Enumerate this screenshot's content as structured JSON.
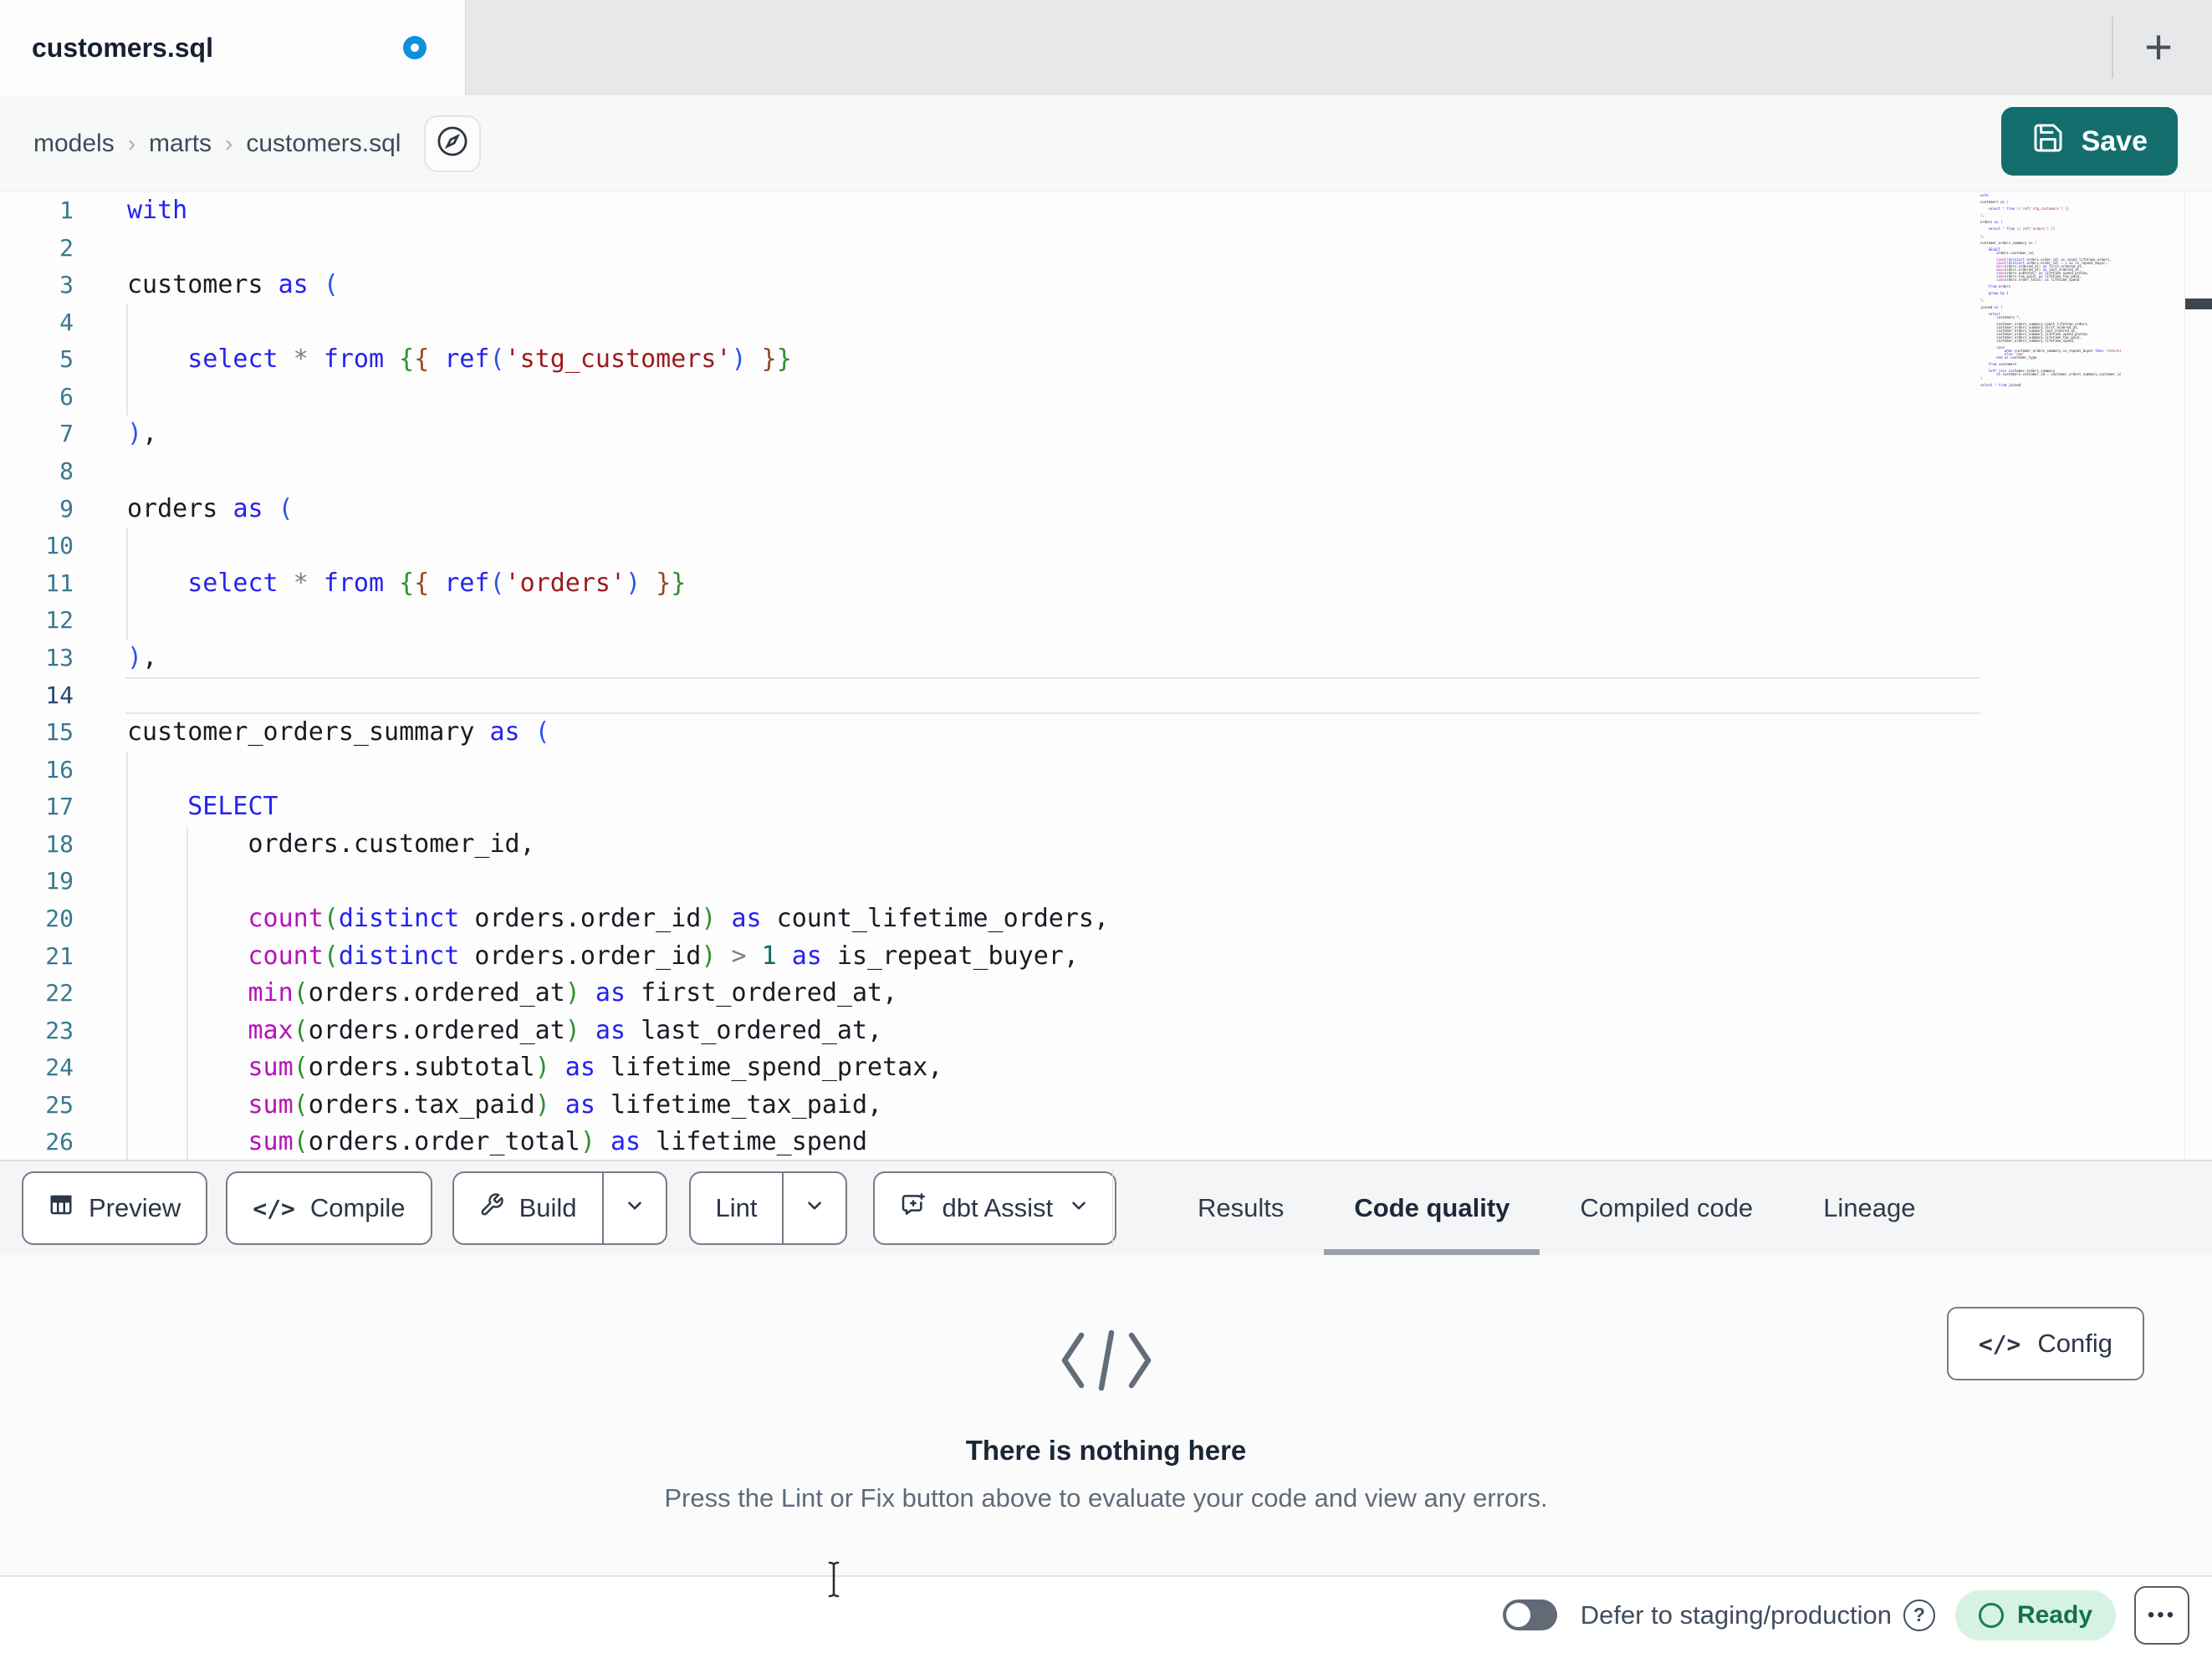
{
  "tab_bar": {
    "active_tab": "customers.sql",
    "new_tab_glyph": "+"
  },
  "breadcrumb": {
    "items": [
      "models",
      "marts",
      "customers.sql"
    ],
    "separator": "›"
  },
  "save_button": {
    "label": "Save"
  },
  "toolbar": {
    "preview": "Preview",
    "compile": "Compile",
    "build": "Build",
    "lint": "Lint",
    "dbt_assist": "dbt Assist",
    "code_glyph": "</>"
  },
  "result_tabs": [
    {
      "label": "Results",
      "active": false
    },
    {
      "label": "Code quality",
      "active": true
    },
    {
      "label": "Compiled code",
      "active": false
    },
    {
      "label": "Lineage",
      "active": false
    }
  ],
  "empty_state": {
    "title": "There is nothing here",
    "subtitle": "Press the Lint or Fix button above to evaluate your code and view any errors.",
    "config_label": "Config",
    "config_glyph": "</>"
  },
  "status_bar": {
    "defer_label": "Defer to staging/production",
    "help_glyph": "?",
    "ready_label": "Ready",
    "menu_glyph": "•••"
  },
  "colors": {
    "accent_teal": "#146e6e",
    "unsaved_dot_blue": "#0f90da",
    "ready_bg": "#d6f2e2",
    "ready_text": "#15714b",
    "syntax_keyword": "#2522f0",
    "syntax_function": "#b712b7",
    "syntax_string": "#9b1b1b",
    "syntax_number": "#0c7060",
    "bracket_level_1": "#2d51e8",
    "bracket_level_2": "#2f8f2f",
    "bracket_level_3": "#96491c"
  },
  "editor": {
    "active_line": 14,
    "lines": [
      {
        "n": "1",
        "guides": [],
        "active": false,
        "tokens": [
          [
            "kw",
            "with"
          ]
        ]
      },
      {
        "n": "2",
        "guides": [],
        "active": false,
        "tokens": []
      },
      {
        "n": "3",
        "guides": [],
        "active": false,
        "tokens": [
          [
            "id",
            "customers "
          ],
          [
            "kw",
            "as "
          ],
          [
            "b1",
            "("
          ]
        ]
      },
      {
        "n": "4",
        "guides": [
          0
        ],
        "active": false,
        "tokens": []
      },
      {
        "n": "5",
        "guides": [
          0
        ],
        "active": false,
        "tokens": [
          [
            "id",
            "    "
          ],
          [
            "kw",
            "select"
          ],
          [
            "id",
            " "
          ],
          [
            "op",
            "*"
          ],
          [
            "id",
            " "
          ],
          [
            "kw",
            "from"
          ],
          [
            "id",
            " "
          ],
          [
            "b2",
            "{"
          ],
          [
            "b3",
            "{"
          ],
          [
            "id",
            " "
          ],
          [
            "kw",
            "ref"
          ],
          [
            "b1",
            "("
          ],
          [
            "str",
            "'stg_customers'"
          ],
          [
            "b1",
            ")"
          ],
          [
            "id",
            " "
          ],
          [
            "b3",
            "}"
          ],
          [
            "b2",
            "}"
          ]
        ]
      },
      {
        "n": "6",
        "guides": [
          0
        ],
        "active": false,
        "tokens": []
      },
      {
        "n": "7",
        "guides": [],
        "active": false,
        "tokens": [
          [
            "b1",
            ")"
          ],
          [
            "id",
            ","
          ]
        ]
      },
      {
        "n": "8",
        "guides": [],
        "active": false,
        "tokens": []
      },
      {
        "n": "9",
        "guides": [],
        "active": false,
        "tokens": [
          [
            "id",
            "orders "
          ],
          [
            "kw",
            "as "
          ],
          [
            "b1",
            "("
          ]
        ]
      },
      {
        "n": "10",
        "guides": [
          0
        ],
        "active": false,
        "tokens": []
      },
      {
        "n": "11",
        "guides": [
          0
        ],
        "active": false,
        "tokens": [
          [
            "id",
            "    "
          ],
          [
            "kw",
            "select"
          ],
          [
            "id",
            " "
          ],
          [
            "op",
            "*"
          ],
          [
            "id",
            " "
          ],
          [
            "kw",
            "from"
          ],
          [
            "id",
            " "
          ],
          [
            "b2",
            "{"
          ],
          [
            "b3",
            "{"
          ],
          [
            "id",
            " "
          ],
          [
            "kw",
            "ref"
          ],
          [
            "b1",
            "("
          ],
          [
            "str",
            "'orders'"
          ],
          [
            "b1",
            ")"
          ],
          [
            "id",
            " "
          ],
          [
            "b3",
            "}"
          ],
          [
            "b2",
            "}"
          ]
        ]
      },
      {
        "n": "12",
        "guides": [
          0
        ],
        "active": false,
        "tokens": []
      },
      {
        "n": "13",
        "guides": [],
        "active": false,
        "tokens": [
          [
            "b1",
            ")"
          ],
          [
            "id",
            ","
          ]
        ]
      },
      {
        "n": "14",
        "guides": [],
        "active": true,
        "tokens": []
      },
      {
        "n": "15",
        "guides": [],
        "active": false,
        "tokens": [
          [
            "id",
            "customer_orders_summary "
          ],
          [
            "kw",
            "as "
          ],
          [
            "b1",
            "("
          ]
        ]
      },
      {
        "n": "16",
        "guides": [
          0
        ],
        "active": false,
        "tokens": []
      },
      {
        "n": "17",
        "guides": [
          0
        ],
        "active": false,
        "tokens": [
          [
            "id",
            "    "
          ],
          [
            "kw",
            "SELECT"
          ]
        ]
      },
      {
        "n": "18",
        "guides": [
          0,
          4
        ],
        "active": false,
        "tokens": [
          [
            "id",
            "        orders.customer_id,"
          ]
        ]
      },
      {
        "n": "19",
        "guides": [
          0,
          4
        ],
        "active": false,
        "tokens": []
      },
      {
        "n": "20",
        "guides": [
          0,
          4
        ],
        "active": false,
        "tokens": [
          [
            "id",
            "        "
          ],
          [
            "fn",
            "count"
          ],
          [
            "b2",
            "("
          ],
          [
            "kw",
            "distinct"
          ],
          [
            "id",
            " orders.order_id"
          ],
          [
            "b2",
            ")"
          ],
          [
            "kw",
            " as"
          ],
          [
            "id",
            " count_lifetime_orders,"
          ]
        ]
      },
      {
        "n": "21",
        "guides": [
          0,
          4
        ],
        "active": false,
        "tokens": [
          [
            "id",
            "        "
          ],
          [
            "fn",
            "count"
          ],
          [
            "b2",
            "("
          ],
          [
            "kw",
            "distinct"
          ],
          [
            "id",
            " orders.order_id"
          ],
          [
            "b2",
            ")"
          ],
          [
            "op",
            " >"
          ],
          [
            "num",
            " 1"
          ],
          [
            "kw",
            " as"
          ],
          [
            "id",
            " is_repeat_buyer,"
          ]
        ]
      },
      {
        "n": "22",
        "guides": [
          0,
          4
        ],
        "active": false,
        "tokens": [
          [
            "id",
            "        "
          ],
          [
            "fn",
            "min"
          ],
          [
            "b2",
            "("
          ],
          [
            "id",
            "orders.ordered_at"
          ],
          [
            "b2",
            ")"
          ],
          [
            "kw",
            " as"
          ],
          [
            "id",
            " first_ordered_at,"
          ]
        ]
      },
      {
        "n": "23",
        "guides": [
          0,
          4
        ],
        "active": false,
        "tokens": [
          [
            "id",
            "        "
          ],
          [
            "fn",
            "max"
          ],
          [
            "b2",
            "("
          ],
          [
            "id",
            "orders.ordered_at"
          ],
          [
            "b2",
            ")"
          ],
          [
            "kw",
            " as"
          ],
          [
            "id",
            " last_ordered_at,"
          ]
        ]
      },
      {
        "n": "24",
        "guides": [
          0,
          4
        ],
        "active": false,
        "tokens": [
          [
            "id",
            "        "
          ],
          [
            "fn",
            "sum"
          ],
          [
            "b2",
            "("
          ],
          [
            "id",
            "orders.subtotal"
          ],
          [
            "b2",
            ")"
          ],
          [
            "kw",
            " as"
          ],
          [
            "id",
            " lifetime_spend_pretax,"
          ]
        ]
      },
      {
        "n": "25",
        "guides": [
          0,
          4
        ],
        "active": false,
        "tokens": [
          [
            "id",
            "        "
          ],
          [
            "fn",
            "sum"
          ],
          [
            "b2",
            "("
          ],
          [
            "id",
            "orders.tax_paid"
          ],
          [
            "b2",
            ")"
          ],
          [
            "kw",
            " as"
          ],
          [
            "id",
            " lifetime_tax_paid,"
          ]
        ]
      },
      {
        "n": "26",
        "guides": [
          0,
          4
        ],
        "active": false,
        "tokens": [
          [
            "id",
            "        "
          ],
          [
            "fn",
            "sum"
          ],
          [
            "b2",
            "("
          ],
          [
            "id",
            "orders.order_total"
          ],
          [
            "b2",
            ")"
          ],
          [
            "kw",
            " as"
          ],
          [
            "id",
            " lifetime_spend"
          ]
        ]
      }
    ],
    "extra_lines": [
      [],
      [
        [
          "id",
          "    "
        ],
        [
          "kw",
          "from"
        ],
        [
          "id",
          " orders"
        ]
      ],
      [],
      [
        [
          "id",
          "    "
        ],
        [
          "kw",
          "group by"
        ],
        [
          "num",
          " 1"
        ]
      ],
      [],
      [
        [
          "b1",
          ")"
        ],
        [
          "id",
          ","
        ]
      ],
      [],
      [
        [
          "id",
          "joined "
        ],
        [
          "kw",
          "as "
        ],
        [
          "b1",
          "("
        ]
      ],
      [],
      [
        [
          "id",
          "    "
        ],
        [
          "kw",
          "select"
        ]
      ],
      [
        [
          "id",
          "        customers.*,"
        ]
      ],
      [],
      [
        [
          "id",
          "        customer_orders_summary.count_lifetime_orders,"
        ]
      ],
      [
        [
          "id",
          "        customer_orders_summary.first_ordered_at,"
        ]
      ],
      [
        [
          "id",
          "        customer_orders_summary.last_ordered_at,"
        ]
      ],
      [
        [
          "id",
          "        customer_orders_summary.lifetime_spend_pretax,"
        ]
      ],
      [
        [
          "id",
          "        customer_orders_summary.lifetime_tax_paid,"
        ]
      ],
      [
        [
          "id",
          "        customer_orders_summary.lifetime_spend,"
        ]
      ],
      [],
      [
        [
          "id",
          "        "
        ],
        [
          "kw",
          "case"
        ]
      ],
      [
        [
          "id",
          "            "
        ],
        [
          "kw",
          "when"
        ],
        [
          "id",
          " customer_orders_summary.is_repeat_buyer "
        ],
        [
          "kw",
          "then"
        ],
        [
          "str",
          " 'returning'"
        ]
      ],
      [
        [
          "id",
          "            "
        ],
        [
          "kw",
          "else"
        ],
        [
          "str",
          " 'new'"
        ]
      ],
      [
        [
          "id",
          "        "
        ],
        [
          "kw",
          "end as"
        ],
        [
          "id",
          " customer_type"
        ]
      ],
      [],
      [
        [
          "id",
          "    "
        ],
        [
          "kw",
          "from"
        ],
        [
          "id",
          " customers"
        ]
      ],
      [],
      [
        [
          "id",
          "    "
        ],
        [
          "kw",
          "left join"
        ],
        [
          "id",
          " customer_orders_summary"
        ]
      ],
      [
        [
          "id",
          "        "
        ],
        [
          "kw",
          "on"
        ],
        [
          "id",
          " customers.customer_id "
        ],
        [
          "op",
          "="
        ],
        [
          "id",
          " customer_orders_summary.customer_id"
        ]
      ],
      [
        [
          "b1",
          ")"
        ]
      ],
      [],
      [
        [
          "kw",
          "select"
        ],
        [
          "op",
          " *"
        ],
        [
          "kw",
          " from"
        ],
        [
          "id",
          " joined"
        ]
      ]
    ]
  }
}
